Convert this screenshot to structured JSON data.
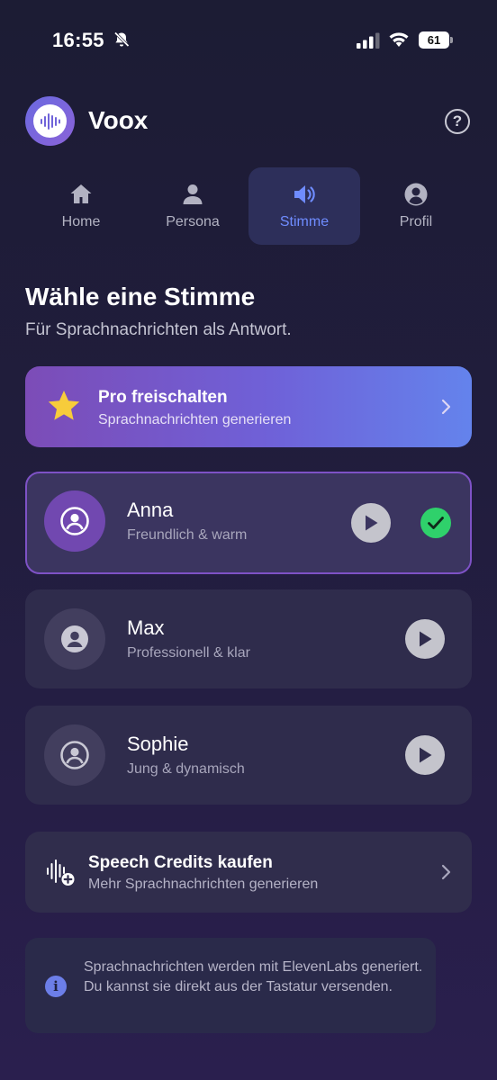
{
  "status_bar": {
    "time": "16:55",
    "battery": "61",
    "icons": [
      "bell-off-icon",
      "signal-icon",
      "wifi-icon",
      "battery-icon"
    ]
  },
  "header": {
    "app_name": "Voox",
    "logo_icon": "waveform-icon",
    "help_label": "?"
  },
  "tabs": [
    {
      "label": "Home",
      "icon": "home-icon",
      "active": false
    },
    {
      "label": "Persona",
      "icon": "person-icon",
      "active": false
    },
    {
      "label": "Stimme",
      "icon": "speaker-icon",
      "active": true
    },
    {
      "label": "Profil",
      "icon": "profile-icon",
      "active": false
    }
  ],
  "main": {
    "title": "Wähle eine Stimme",
    "subtitle": "Für Sprachnachrichten als Antwort."
  },
  "pro_banner": {
    "title": "Pro freischalten",
    "subtitle": "Sprachnachrichten generieren",
    "icon": "star-icon"
  },
  "voices": [
    {
      "name": "Anna",
      "description": "Freundlich & warm",
      "selected": true
    },
    {
      "name": "Max",
      "description": "Professionell & klar",
      "selected": false
    },
    {
      "name": "Sophie",
      "description": "Jung & dynamisch",
      "selected": false
    }
  ],
  "credits": {
    "title": "Speech Credits kaufen",
    "subtitle": "Mehr Sprachnachrichten generieren",
    "icon": "waveform-plus-icon"
  },
  "info": {
    "icon_label": "i",
    "text": "Sprachnachrichten werden mit ElevenLabs generiert. Du kannst sie direkt aus der Tastatur versenden."
  },
  "colors": {
    "accent_blue": "#6f8cff",
    "accent_purple": "#7e52c6",
    "check_green": "#2fd16b",
    "star_yellow": "#f7cc3b"
  }
}
